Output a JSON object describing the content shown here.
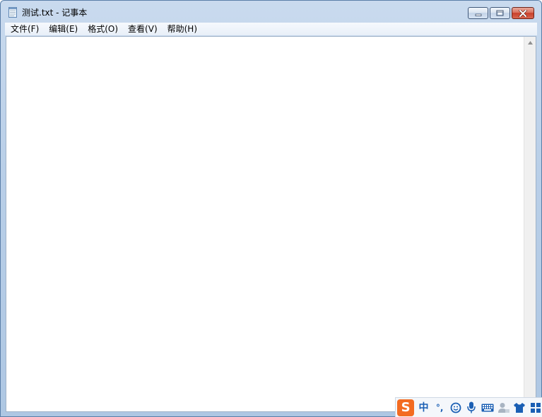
{
  "window": {
    "title": "测试.txt - 记事本"
  },
  "menu": {
    "items": [
      {
        "label": "文件(F)"
      },
      {
        "label": "编辑(E)"
      },
      {
        "label": "格式(O)"
      },
      {
        "label": "查看(V)"
      },
      {
        "label": "帮助(H)"
      }
    ]
  },
  "editor": {
    "content": ""
  },
  "ime": {
    "logo": "S",
    "mode": "中",
    "punct": "°,",
    "icons": [
      "emoji-icon",
      "microphone-icon",
      "keyboard-icon",
      "user-icon",
      "skin-icon",
      "toolbox-icon"
    ]
  },
  "colors": {
    "titlebar": "#b9cfe8",
    "close_button": "#c8402a",
    "ime_logo": "#f36b21",
    "ime_icon": "#1a5fb4"
  }
}
